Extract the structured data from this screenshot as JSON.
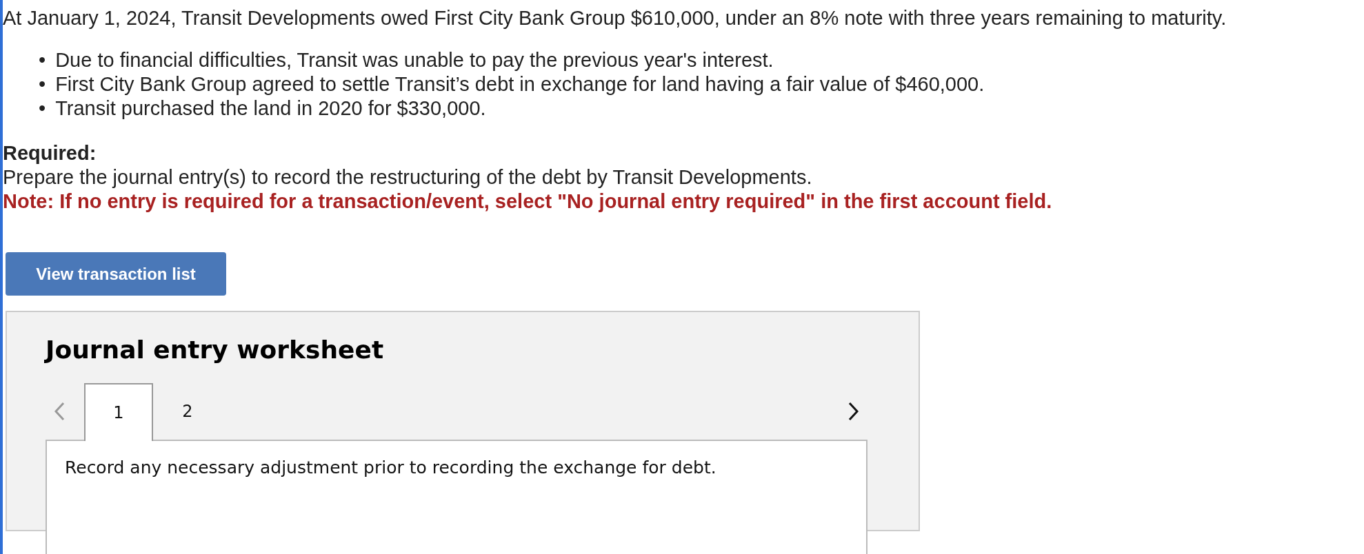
{
  "intro": "At January 1, 2024, Transit Developments owed First City Bank Group $610,000, under an 8% note with three years remaining to maturity.",
  "bullets": [
    {
      "marker": "•",
      "text": "Due to financial difficulties, Transit was unable to pay the previous year's interest."
    },
    {
      "marker": "•",
      "text": "First City Bank Group agreed to settle Transit’s debt in exchange for land having a fair value of $460,000."
    },
    {
      "marker": "•",
      "text": "Transit purchased the land in 2020 for $330,000."
    }
  ],
  "required": {
    "heading": "Required:",
    "text": "Prepare the journal entry(s) to record the restructuring of the debt by Transit Developments.",
    "note": "Note: If no entry is required for a transaction/event, select \"No journal entry required\" in the first account field."
  },
  "button": "View transaction list",
  "worksheet": {
    "title": "Journal entry worksheet",
    "prev": {
      "disabled": true
    },
    "next": {
      "disabled": false
    },
    "tabs": [
      {
        "label": "1",
        "selected": true
      },
      {
        "label": "2",
        "selected": false
      }
    ],
    "instruction": "Record any necessary adjustment prior to recording the exchange for debt."
  }
}
